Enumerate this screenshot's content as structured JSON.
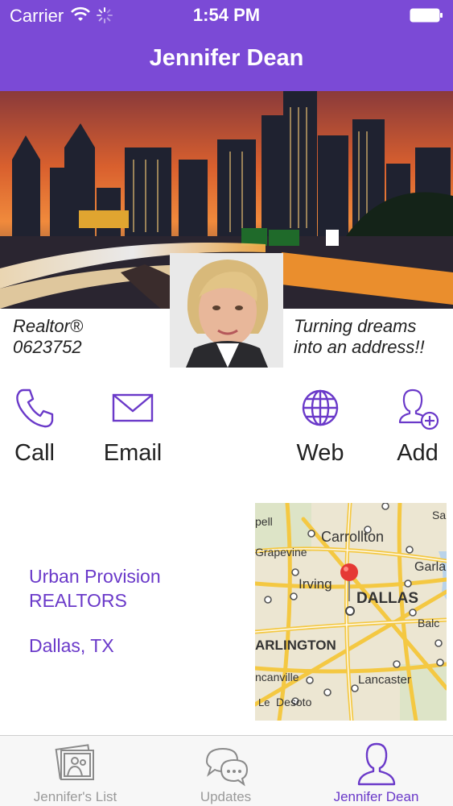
{
  "status_bar": {
    "carrier": "Carrier",
    "time": "1:54 PM"
  },
  "nav": {
    "title": "Jennifer Dean"
  },
  "profile": {
    "title_line1": "Realtor®",
    "title_line2": "0623752",
    "tagline_line1": "Turning dreams",
    "tagline_line2": "into an address!!"
  },
  "actions": [
    {
      "label": "Call",
      "icon": "phone-icon"
    },
    {
      "label": "Email",
      "icon": "envelope-icon"
    },
    {
      "label": "Web",
      "icon": "globe-icon"
    },
    {
      "label": "Add",
      "icon": "add-contact-icon"
    }
  ],
  "office": {
    "line1": "Urban Provision",
    "line2": "REALTORS",
    "city": "Dallas, TX"
  },
  "map": {
    "labels": {
      "carrollton": "Carrollton",
      "grapevine": "Grapevine",
      "irving": "Irving",
      "dallas": "DALLAS",
      "arlington": "ARLINGTON",
      "lancaster": "Lancaster",
      "garland": "Garla",
      "balch": "Balc",
      "duncanville": "ncanville",
      "desoto": "Desoto",
      "cedarhill": "Le",
      "sachse": "Sa",
      "coppell": "pell"
    }
  },
  "tabs": [
    {
      "label": "Jennifer's List",
      "icon": "photos-icon",
      "active": false
    },
    {
      "label": "Updates",
      "icon": "chat-bubbles-icon",
      "active": false
    },
    {
      "label": "Jennifer Dean",
      "icon": "person-icon",
      "active": true
    }
  ],
  "colors": {
    "accent": "#7b4ad6",
    "link": "#6a39c9",
    "map_pin": "#e53935"
  }
}
